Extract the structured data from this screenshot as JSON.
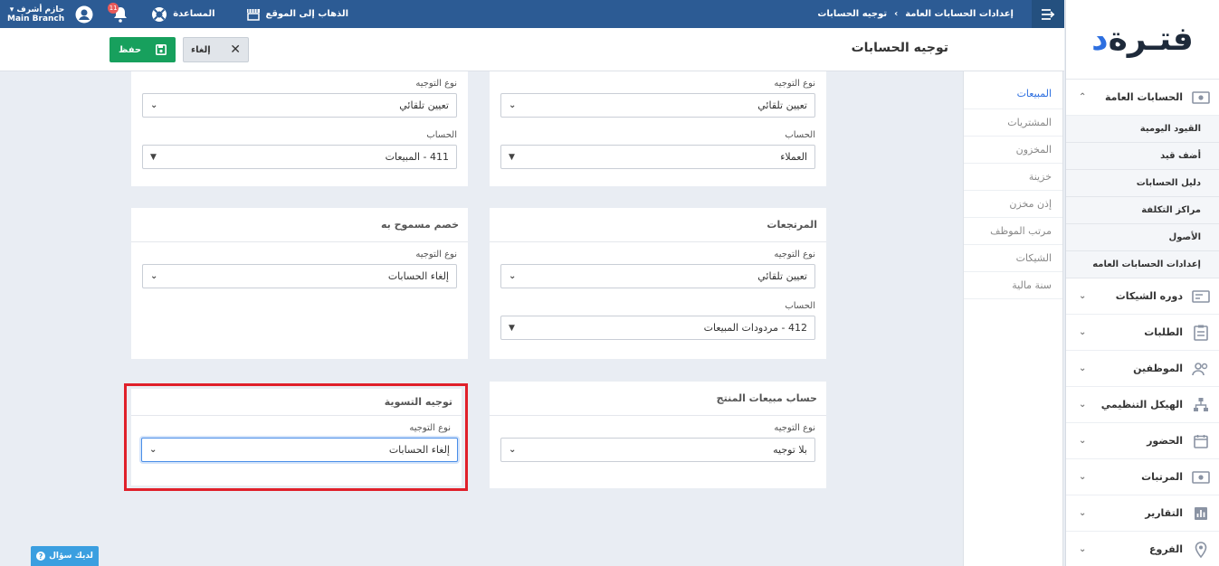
{
  "logo": {
    "text_main": "فتـرة",
    "text_accent": "د"
  },
  "sidebar": {
    "active_section": {
      "label": "الحسابات العامة",
      "icon": "money-icon"
    },
    "subitems": [
      "القيود اليومية",
      "أضف قيد",
      "دليل الحسابات",
      "مراكز التكلفة",
      "الأصول",
      "إعدادات الحسابات العامه"
    ],
    "sections": [
      {
        "label": "دوره الشيكات",
        "icon": "cheque-icon"
      },
      {
        "label": "الطلبات",
        "icon": "clipboard-icon"
      },
      {
        "label": "الموظفين",
        "icon": "users-icon"
      },
      {
        "label": "الهيكل التنظيمي",
        "icon": "org-chart-icon"
      },
      {
        "label": "الحضور",
        "icon": "calendar-icon"
      },
      {
        "label": "المرتبات",
        "icon": "money-icon"
      },
      {
        "label": "التقارير",
        "icon": "chart-icon"
      },
      {
        "label": "الفروع",
        "icon": "location-icon"
      }
    ]
  },
  "topbar": {
    "breadcrumb_parent": "إعدادات الحسابات العامة",
    "breadcrumb_current": "توجيه الحسابات",
    "go_to_site": "الذهاب إلى الموقع",
    "help": "المساعدة",
    "notifications_count": "11",
    "user_name": "حازم أشرف",
    "branch": "Main Branch"
  },
  "page": {
    "title": "توجيه الحسابات",
    "save_label": "حفظ",
    "cancel_label": "إلغاء"
  },
  "tabs": [
    "المبيعات",
    "المشتريات",
    "المخزون",
    "خزينة",
    "إذن مخزن",
    "مرتب الموظف",
    "الشيكات",
    "سنة مالية"
  ],
  "cards": {
    "top_right": {
      "type_label": "نوع التوجيه",
      "type_value": "تعيين تلقائي",
      "account_label": "الحساب",
      "account_value": "العملاء"
    },
    "top_left": {
      "type_label": "نوع التوجيه",
      "type_value": "تعيين تلقائي",
      "account_label": "الحساب",
      "account_value": "411 - المبيعات"
    },
    "returns": {
      "title": "المرتجعات",
      "type_label": "نوع التوجيه",
      "type_value": "تعيين تلقائي",
      "account_label": "الحساب",
      "account_value": "412 - مردودات المبيعات"
    },
    "discount": {
      "title": "خصم مسموح به",
      "type_label": "نوع التوجيه",
      "type_value": "إلغاء الحسابات"
    },
    "product_sales": {
      "title": "حساب مبيعات المنتج",
      "type_label": "نوع التوجيه",
      "type_value": "بلا توجيه"
    },
    "settlement": {
      "title": "توجيه التسوية",
      "type_label": "نوع التوجيه",
      "type_value": "إلغاء الحسابات"
    }
  },
  "help_button": "لديك سؤال"
}
